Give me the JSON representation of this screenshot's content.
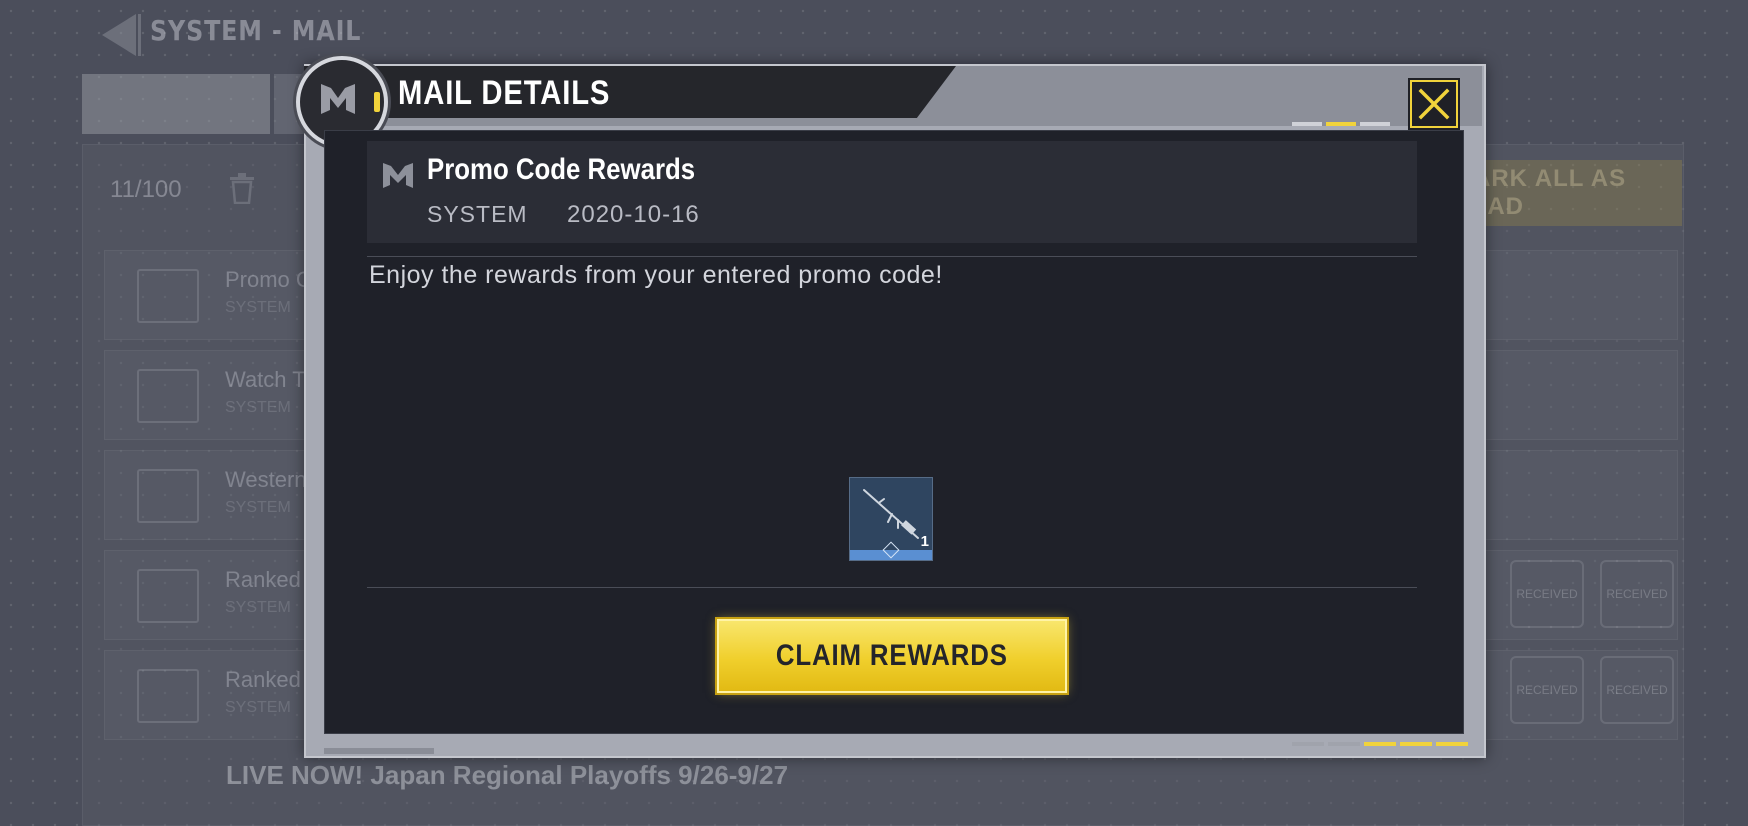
{
  "background": {
    "title": "SYSTEM - MAIL",
    "mail_count": "11/100",
    "mark_all_label": "MARK ALL AS READ",
    "rows": [
      {
        "title": "Promo Co",
        "sender": "SYSTEM"
      },
      {
        "title": "Watch To",
        "sender": "SYSTEM"
      },
      {
        "title": "Western E",
        "sender": "SYSTEM"
      },
      {
        "title": "Ranked M",
        "sender": "SYSTEM"
      },
      {
        "title": "Ranked M",
        "sender": "SYSTEM"
      }
    ],
    "badge_label": "RECEIVED",
    "live_row_title": "LIVE NOW! Japan Regional Playoffs 9/26-9/27"
  },
  "modal": {
    "title": "MAIL DETAILS",
    "subject": "Promo Code Rewards",
    "sender": "SYSTEM",
    "date": "2020-10-16",
    "message": "Enjoy the rewards from your entered promo code!",
    "reward": {
      "icon": "rifle-icon",
      "quantity": "1"
    },
    "claim_label": "CLAIM REWARDS"
  },
  "colors": {
    "accent": "#f1d33b",
    "panel": "#1f2129",
    "frame": "#a7aab4"
  }
}
